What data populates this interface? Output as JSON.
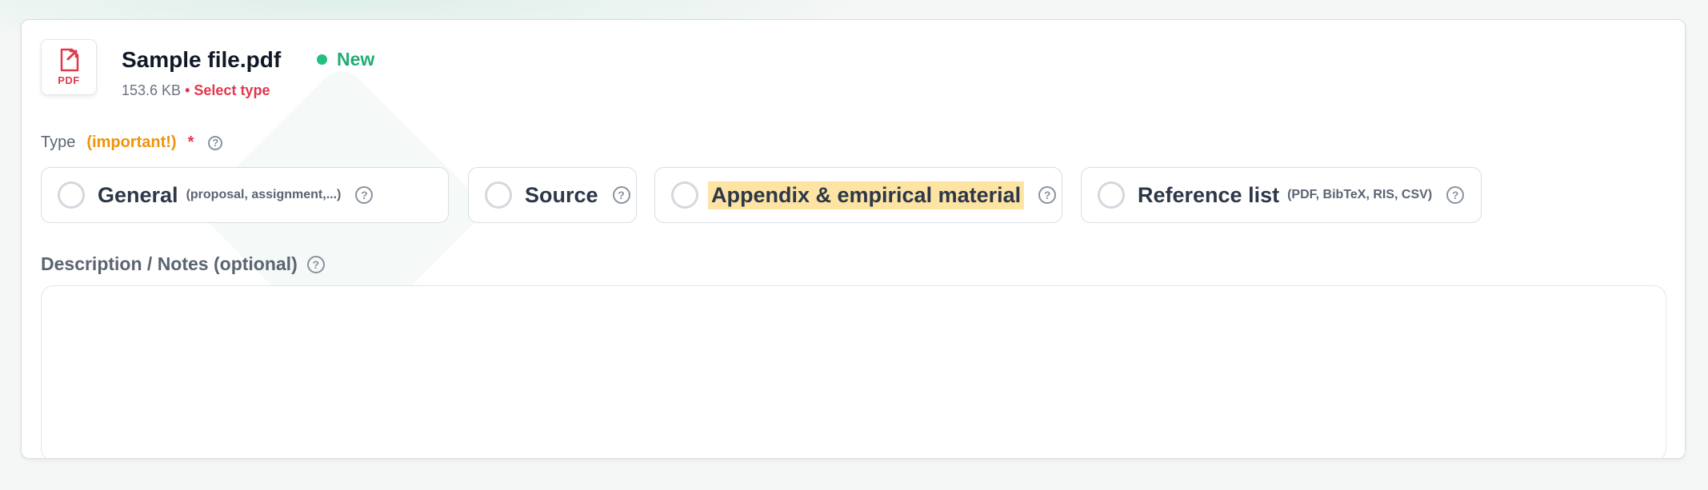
{
  "file": {
    "name": "Sample file.pdf",
    "icon_label": "PDF",
    "status": "New",
    "size": "153.6 KB",
    "separator": "•",
    "select_type_prompt": "Select type"
  },
  "type_field": {
    "label": "Type",
    "important": "(important!)",
    "required_marker": "*",
    "help_glyph": "?",
    "options": [
      {
        "label": "General",
        "hint": "(proposal, assignment,...)",
        "selected": false,
        "highlighted": false
      },
      {
        "label": "Source",
        "hint": "",
        "selected": false,
        "highlighted": false
      },
      {
        "label": "Appendix & empirical material",
        "hint": "",
        "selected": false,
        "highlighted": true
      },
      {
        "label": "Reference list",
        "hint": "(PDF, BibTeX, RIS, CSV)",
        "selected": false,
        "highlighted": false
      }
    ]
  },
  "notes_field": {
    "label": "Description / Notes (optional)",
    "value": "",
    "placeholder": ""
  },
  "colors": {
    "status_green": "#1fae73",
    "accent_red": "#e0384d",
    "important_orange": "#f0920b",
    "highlight_yellow": "#fde4a3"
  },
  "icons": {
    "file": "pdf-file-icon",
    "status": "green-dot-icon",
    "help": "question-circle-icon",
    "radio": "radio-unchecked-icon"
  }
}
